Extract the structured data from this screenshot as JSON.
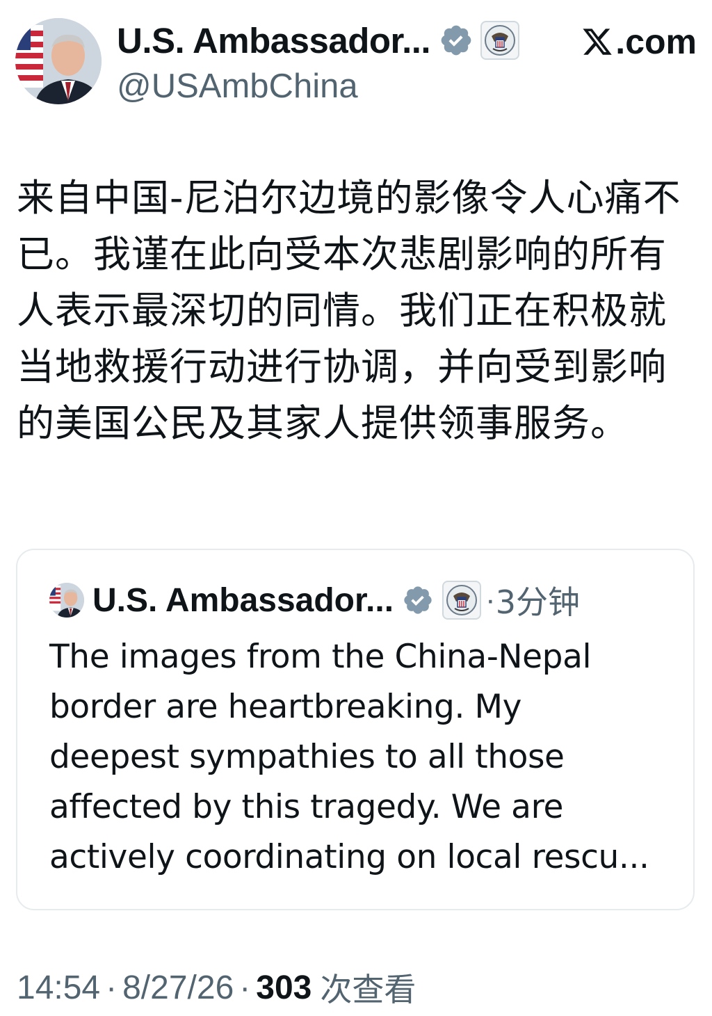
{
  "author": {
    "display_name": "U.S. Ambassador...",
    "handle": "@USAmbChina",
    "avatar_icon": "person-portrait-with-us-flag",
    "verified_icon": "verified-badge-icon",
    "affiliation_icon": "embassy-seal-icon"
  },
  "source": {
    "label": ".com",
    "logo_icon": "x-logo-icon"
  },
  "tweet": {
    "text": "来自中国-尼泊尔边境的影像令人心痛不已。我谨在此向受本次悲剧影响的所有人表示最深切的同情。我们正在积极就当地救援行动进行协调，并向受到影响的美国公民及其家人提供领事服务。"
  },
  "quoted": {
    "display_name": "U.S. Ambassador...",
    "separator": "·",
    "time": "3分钟",
    "lines": [
      "The images from the China-Nepal",
      "border are heartbreaking. My",
      "deepest sympathies to all those",
      "affected by this tragedy. We are",
      "actively coordinating on local rescu..."
    ]
  },
  "meta": {
    "time": "14:54",
    "separator": "·",
    "date": "8/27/26",
    "views_count": "303",
    "views_label": "次查看"
  },
  "colors": {
    "text_primary": "#0f1419",
    "text_secondary": "#536471",
    "verified_badge": "#829aab",
    "card_border": "#e6ebee"
  }
}
